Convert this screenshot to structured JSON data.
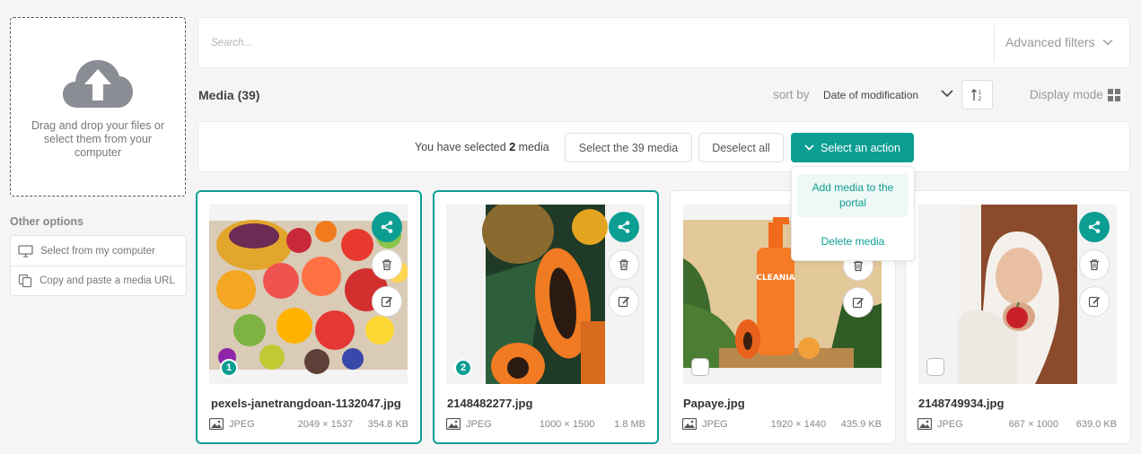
{
  "upload": {
    "dropzone_text": "Drag and drop your files or select them from your computer",
    "other_options_title": "Other options",
    "options": [
      {
        "label": "Select from my computer",
        "icon": "monitor-icon"
      },
      {
        "label": "Copy and paste a media URL",
        "icon": "copy-icon"
      }
    ]
  },
  "search": {
    "placeholder": "Search...",
    "advanced_filters_label": "Advanced filters"
  },
  "toolbar": {
    "title": "Media (39)",
    "sort_by_label": "sort by",
    "sort_value": "Date of modification",
    "display_mode_label": "Display mode"
  },
  "selection": {
    "text_prefix": "You have selected",
    "count": "2",
    "text_suffix": "media",
    "select_all_label": "Select the 39 media",
    "deselect_label": "Deselect all",
    "action_label": "Select an action"
  },
  "action_menu": {
    "items": [
      "Add media to the portal",
      "Delete media"
    ]
  },
  "media": [
    {
      "filename": "pexels-janetrangdoan-1132047.jpg",
      "type": "JPEG",
      "dimensions": "2049 × 1537",
      "size": "354.8 KB",
      "selected": true,
      "order": "1"
    },
    {
      "filename": "2148482277.jpg",
      "type": "JPEG",
      "dimensions": "1000 × 1500",
      "size": "1.8 MB",
      "selected": true,
      "order": "2"
    },
    {
      "filename": "Papaye.jpg",
      "type": "JPEG",
      "dimensions": "1920 × 1440",
      "size": "435.9 KB",
      "selected": false,
      "image_text": "CLEANIA"
    },
    {
      "filename": "2148749934.jpg",
      "type": "JPEG",
      "dimensions": "667 × 1000",
      "size": "639.0 KB",
      "selected": false
    }
  ],
  "colors": {
    "accent": "#0d9e93",
    "background": "#f5f5f6"
  }
}
